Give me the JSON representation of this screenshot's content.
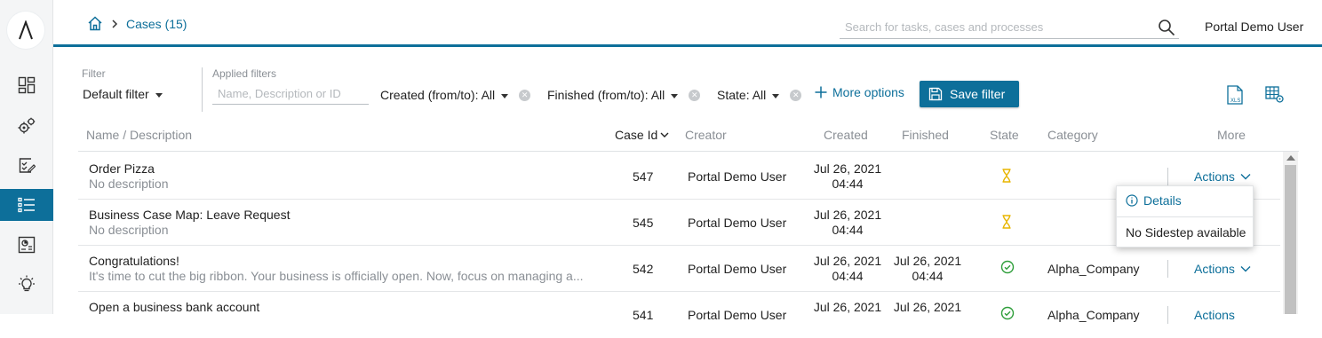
{
  "breadcrumb": {
    "current": "Cases (15)"
  },
  "search": {
    "placeholder": "Search for tasks, cases and processes"
  },
  "user": {
    "name": "Portal Demo User"
  },
  "filter": {
    "label": "Filter",
    "selected": "Default filter",
    "applied_label": "Applied filters",
    "name_placeholder": "Name, Description or ID",
    "created": "Created (from/to): All",
    "finished": "Finished (from/to): All",
    "state": "State: All",
    "more_options": "More options",
    "save_filter": "Save filter"
  },
  "table": {
    "headers": {
      "name": "Name / Description",
      "case_id": "Case Id",
      "creator": "Creator",
      "created": "Created",
      "finished": "Finished",
      "state": "State",
      "category": "Category",
      "more": "More"
    },
    "rows": [
      {
        "name": "Order Pizza",
        "description": "No description",
        "id": "547",
        "creator": "Portal Demo User",
        "created_date": "Jul 26, 2021",
        "created_time": "04:44",
        "finished_date": "",
        "finished_time": "",
        "state": "hourglass-icon",
        "category": "",
        "actions": "Actions"
      },
      {
        "name": "Business Case Map: Leave Request",
        "description": "No description",
        "id": "545",
        "creator": "Portal Demo User",
        "created_date": "Jul 26, 2021",
        "created_time": "04:44",
        "finished_date": "",
        "finished_time": "",
        "state": "hourglass-icon",
        "category": "",
        "actions": ""
      },
      {
        "name": "Congratulations!",
        "description": "It's time to cut the big ribbon. Your business is officially open. Now, focus on managing a...",
        "id": "542",
        "creator": "Portal Demo User",
        "created_date": "Jul 26, 2021",
        "created_time": "04:44",
        "finished_date": "Jul 26, 2021",
        "finished_time": "04:44",
        "state": "check-circle-icon",
        "category": "Alpha_Company",
        "actions": "Actions"
      },
      {
        "name": "Open a business bank account",
        "description": "",
        "id": "541",
        "creator": "Portal Demo User",
        "created_date": "Jul 26, 2021",
        "created_time": "",
        "finished_date": "Jul 26, 2021",
        "finished_time": "",
        "state": "check-circle-icon",
        "category": "Alpha_Company",
        "actions": "Actions"
      }
    ]
  },
  "popup": {
    "details": "Details",
    "no_sidestep": "No Sidestep available"
  },
  "colors": {
    "primary": "#0d6f9a",
    "pending": "#e8b500",
    "done": "#2e9e3a"
  }
}
